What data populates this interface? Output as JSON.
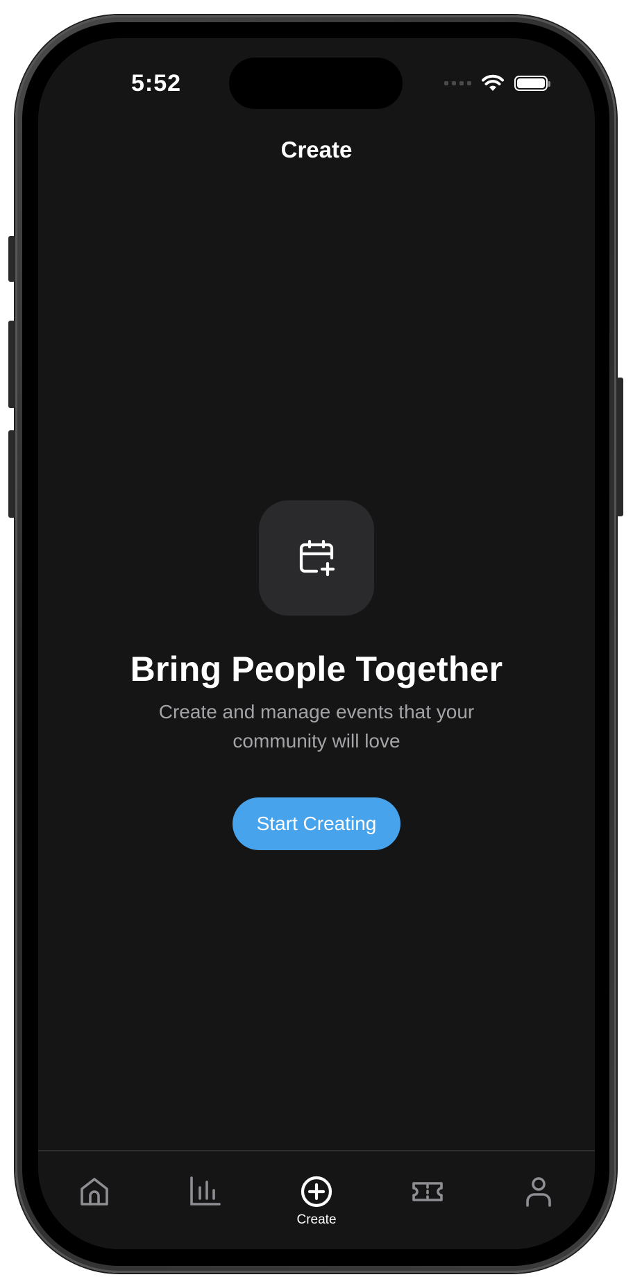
{
  "status_bar": {
    "time": "5:52",
    "icons": [
      "cellular-signal-icon",
      "wifi-icon",
      "battery-icon"
    ]
  },
  "header": {
    "title": "Create"
  },
  "empty_state": {
    "icon": "calendar-plus-icon",
    "headline": "Bring People Together",
    "description": "Create and manage events that your community will love",
    "cta_label": "Start Creating"
  },
  "tab_bar": {
    "items": [
      {
        "icon": "home-icon",
        "label": "",
        "active": false
      },
      {
        "icon": "bar-chart-icon",
        "label": "",
        "active": false
      },
      {
        "icon": "plus-circle-icon",
        "label": "Create",
        "active": true
      },
      {
        "icon": "ticket-icon",
        "label": "",
        "active": false
      },
      {
        "icon": "user-icon",
        "label": "",
        "active": false
      }
    ]
  },
  "colors": {
    "background": "#151516",
    "accent": "#47a3ec",
    "tile": "#2a2a2c",
    "inactive_icon": "#8e8e93",
    "secondary_text": "#a4a4a8"
  }
}
